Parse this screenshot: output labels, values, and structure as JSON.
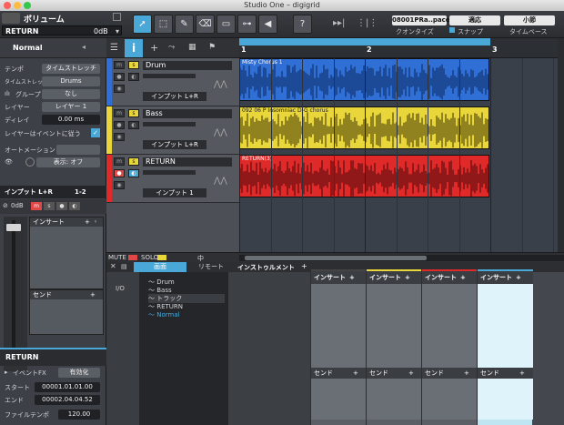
{
  "window": {
    "title": "Studio One – digigrid"
  },
  "toolbar": {
    "volume_label": "ボリューム",
    "track_selector": "RETURN",
    "track_level": "0dB",
    "help_label": "?",
    "song_position": "08001PRa..pace",
    "quantize_value": "適応",
    "quantize_label": "クオンタイズ",
    "snap_label": "スナップ",
    "timebase_value": "小節",
    "timebase_label": "タイムベース"
  },
  "inspector": {
    "preset_name": "Normal",
    "rows": [
      {
        "label": "テンポ",
        "value": "タイムストレッチ"
      },
      {
        "label": "タイムストレッチ",
        "value": "Drums"
      },
      {
        "label": "グループ",
        "value": "なし"
      },
      {
        "label": "レイヤー",
        "value": "レイヤー 1"
      },
      {
        "label": "ディレイ",
        "value": "0.00 ms"
      }
    ],
    "follow_events_label": "レイヤーはイベントに従う",
    "automation_label": "オートメーション",
    "display_label": "表示: オフ",
    "channel_name": "インプット L+R",
    "channel_number": "1-2",
    "channel_level": "0dB",
    "insert_label": "インサート",
    "send_label": "センド",
    "bottom_track_name": "RETURN",
    "event_fx_label": "イベントFX",
    "event_fx_value": "有効化",
    "start_label": "スタート",
    "start_value": "00001.01.01.00",
    "end_label": "エンド",
    "end_value": "00002.04.04.52",
    "file_tempo_label": "ファイルテンポ",
    "file_tempo_value": "120.00"
  },
  "tracks": [
    {
      "name": "Drum",
      "input": "インプット L+R",
      "color": "#2f6fd6",
      "clip": "Misty Chorus 1"
    },
    {
      "name": "Bass",
      "input": "インプット L+R",
      "color": "#e8d63a",
      "clip": "092 06 P Insomniac D-G chorus"
    },
    {
      "name": "RETURN",
      "input": "インプット 1",
      "color": "#e02a2a",
      "clip": "RETURN(3)"
    }
  ],
  "ruler": {
    "marks": [
      "1",
      "2",
      "3"
    ]
  },
  "statusbar": {
    "mute": "MUTE",
    "solo": "SOLO",
    "center": "中"
  },
  "console": {
    "tabs": [
      "画面",
      "リモート"
    ],
    "io_label": "I/O",
    "instrument_label": "インストゥルメント",
    "nav_items": [
      "Drum",
      "Bass",
      "トラック",
      "RETURN",
      "Normal"
    ],
    "insert_label": "インサート",
    "send_label": "センド"
  },
  "colors": {
    "accent": "#4aa8d8",
    "drum": "#2f6fd6",
    "bass": "#e8d63a",
    "return": "#e02a2a"
  }
}
